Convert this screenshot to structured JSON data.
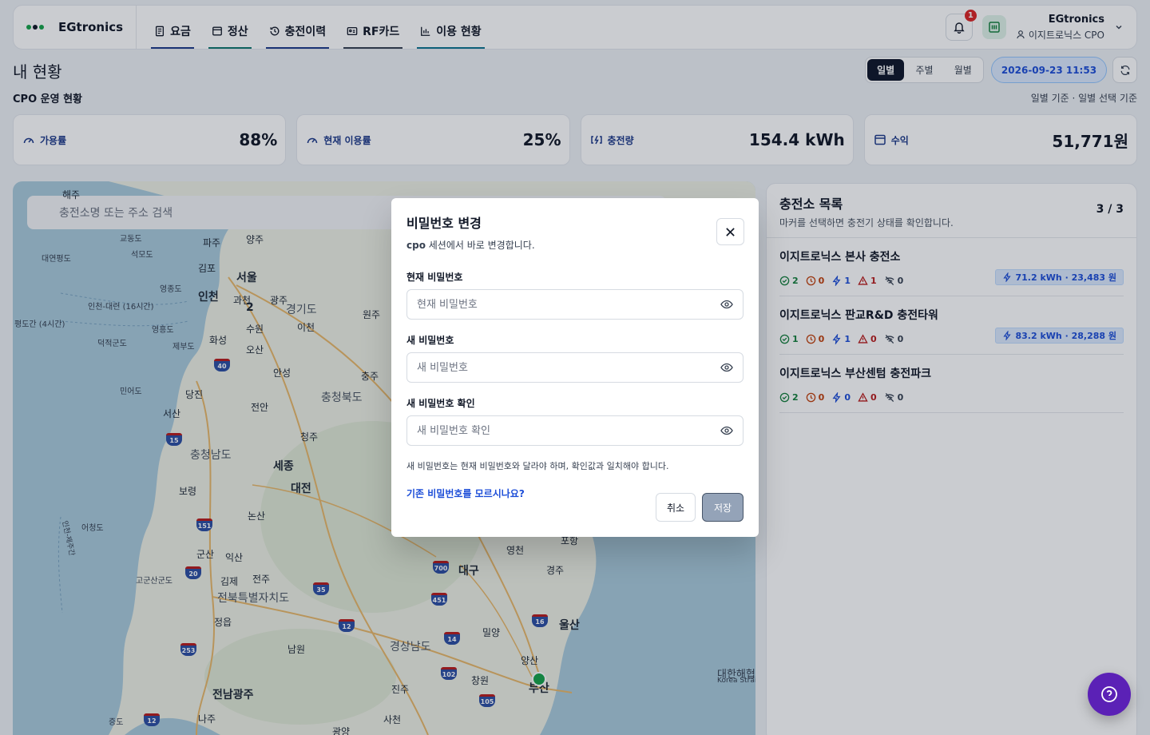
{
  "app": {
    "brand_name": "EGtronics",
    "brand_colors": [
      "#16a34a",
      "#111827",
      "#16a34a"
    ]
  },
  "nav": [
    {
      "label": "요금",
      "icon": "document-icon"
    },
    {
      "label": "정산",
      "icon": "receipt-icon"
    },
    {
      "label": "충전이력",
      "icon": "history-icon"
    },
    {
      "label": "RF카드",
      "icon": "card-icon"
    },
    {
      "label": "이용 현황",
      "icon": "bar-chart-icon"
    }
  ],
  "header": {
    "notification_count": "1",
    "user_name": "EGtronics",
    "user_role": "이지트로닉스 CPO"
  },
  "page": {
    "title": "내 현황",
    "section_title": "CPO 운영 현황",
    "section_note": "일별 기준 · 일별 선택 기준",
    "period_tabs": [
      "일별",
      "주별",
      "월별"
    ],
    "active_period": "일별",
    "datetime": "2026-09-23 11:53"
  },
  "kpis": [
    {
      "label": "가용률",
      "value": "88%",
      "icon": "gauge-icon"
    },
    {
      "label": "현재 이용률",
      "value": "25%",
      "icon": "gauge-icon"
    },
    {
      "label": "충전량",
      "value": "154.4 kWh",
      "icon": "charging-icon"
    },
    {
      "label": "수익",
      "value": "51,771원",
      "icon": "wallet-icon"
    }
  ],
  "map": {
    "search_placeholder": "충전소명 또는 주소 검색",
    "cities": [
      "서울",
      "인천",
      "세종",
      "대전",
      "대구",
      "울산",
      "부산",
      "전남광주"
    ],
    "regions": [
      "경기도",
      "충청북도",
      "충청남도",
      "전북특별자치도",
      "경상남도"
    ],
    "towns": [
      "파주",
      "양주",
      "김포",
      "과천",
      "광주",
      "수원",
      "이천",
      "원주",
      "화성",
      "오산",
      "안성",
      "충주",
      "당진",
      "서산",
      "전안",
      "청주",
      "보령",
      "논산",
      "군산",
      "익산",
      "김제",
      "전주",
      "정읍",
      "남원",
      "영천",
      "포항",
      "경주",
      "밀양",
      "양산",
      "창원",
      "진주",
      "사천",
      "나주",
      "광양"
    ],
    "sea_labels": [
      "교동도",
      "석모도",
      "대연평도",
      "영종도",
      "영흥도",
      "제부도",
      "덕적군도",
      "인천-대련 (16시간)",
      "평도간 (4시간)",
      "어청도",
      "고군산군도",
      "민어도",
      "증도",
      "대한해협",
      "Korea Strait",
      "인천-제주간",
      "해주",
      "2"
    ],
    "highways": [
      "40",
      "15",
      "151",
      "20",
      "35",
      "12",
      "253",
      "451",
      "700",
      "14",
      "16",
      "102",
      "105"
    ]
  },
  "stations": {
    "title": "충전소 목록",
    "subtitle": "마커를 선택하면 충전기 상태를 확인합니다.",
    "count": "3 / 3",
    "items": [
      {
        "name": "이지트로닉스 본사 충전소",
        "available": "2",
        "waiting": "0",
        "charging": "1",
        "fault": "1",
        "offline": "0",
        "energy": "71.2 kWh · 23,483 원"
      },
      {
        "name": "이지트로닉스 판교R&D 충전타워",
        "available": "1",
        "waiting": "0",
        "charging": "1",
        "fault": "0",
        "offline": "0",
        "energy": "83.2 kWh · 28,288 원"
      },
      {
        "name": "이지트로닉스 부산센텀 충전파크",
        "available": "2",
        "waiting": "0",
        "charging": "0",
        "fault": "0",
        "offline": "0",
        "energy": ""
      }
    ]
  },
  "modal": {
    "title": "비밀번호 변경",
    "subtitle_prefix": "cpo",
    "subtitle_rest": " 세션에서 바로 변경합니다.",
    "current_label": "현재 비밀번호",
    "current_placeholder": "현재 비밀번호",
    "new_label": "새 비밀번호",
    "new_placeholder": "새 비밀번호",
    "confirm_label": "새 비밀번호 확인",
    "confirm_placeholder": "새 비밀번호 확인",
    "hint": "새 비밀번호는 현재 비밀번호와 달라야 하며, 확인값과 일치해야 합니다.",
    "forgot_link": "기존 비밀번호를 모르시나요?",
    "cancel_label": "취소",
    "save_label": "저장"
  }
}
